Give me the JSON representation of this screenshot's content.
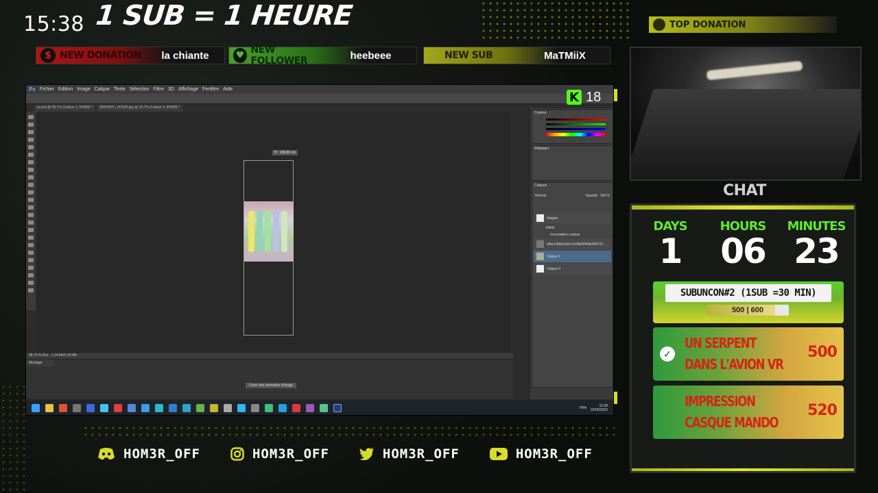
{
  "clock": "15:38",
  "headline": "1 SUB = 1 HEURE",
  "alerts": {
    "donation": {
      "tag": "NEW DONATION",
      "value": "la chiante"
    },
    "follower": {
      "tag": "NEW FOLLOWER",
      "value": "heebeee"
    },
    "sub": {
      "tag": "NEW SUB",
      "value": "MaTMiiX"
    }
  },
  "top_donation": "TOP DONATION",
  "kick_viewers": "18",
  "photoshop": {
    "logo": "Ps",
    "menu": [
      "Fichier",
      "Edition",
      "Image",
      "Calque",
      "Texte",
      "Sélection",
      "Filtre",
      "3D",
      "Affichage",
      "Fenêtre",
      "Aide"
    ],
    "tabs": [
      "tu.psd @ 28,7% (Calque 1, RVB/8) *",
      "20250922_141045.jpg @ 16,7% (Calque 0, RVB/8) *"
    ],
    "measure": "H : 199,90 cm",
    "status": "28,75 %       Doc : 1,14 Mo/1,00 Mo",
    "timeline_label": "Montage",
    "timeline_button": "Créer une animation d'image",
    "layers": [
      "Images",
      "Effets",
      "Incrustation couleur",
      "elfac14d9c0a0e7ecf9e0044be69f737...",
      "Calque 1",
      "Calque 0"
    ],
    "layer_mode": "Normal",
    "opacity": "Opacité : 100 %",
    "panel_color": "Couleur",
    "panel_adjust": "Réglages",
    "panel_layers": "Calques"
  },
  "taskbar": {
    "lang": "FRA",
    "time": "15:38",
    "date": "22/09/2025"
  },
  "chat_label": "CHAT",
  "timer": {
    "days_label": "DAYS",
    "hours_label": "HOURS",
    "minutes_label": "MINUTES",
    "days": "1",
    "hours": "06",
    "minutes": "23"
  },
  "goal": {
    "title": "SUBUNCON#2 (1SUB =30 MIN)",
    "progress_text": "500 | 600",
    "current": 500,
    "target": 600
  },
  "rewards": [
    {
      "text": "UN SERPENT DANS L'AVION VR",
      "cost": "500",
      "done": true
    },
    {
      "text": "IMPRESSION CASQUE MANDO",
      "cost": "520",
      "done": false
    }
  ],
  "socials": [
    {
      "icon": "discord-icon",
      "handle": "HOM3R_OFF"
    },
    {
      "icon": "instagram-icon",
      "handle": "HOM3R_OFF"
    },
    {
      "icon": "twitter-icon",
      "handle": "HOM3R_OFF"
    },
    {
      "icon": "youtube-icon",
      "handle": "HOM3R_OFF"
    }
  ],
  "colors": {
    "accent": "#d7dc2a",
    "kick": "#53fc18",
    "timer_label": "#5fe832",
    "reward_text": "#d62415"
  }
}
